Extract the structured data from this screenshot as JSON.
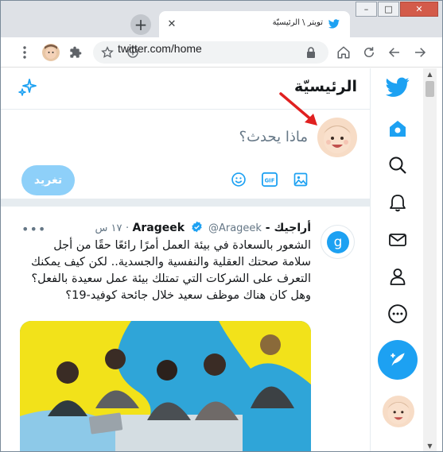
{
  "browser": {
    "tab_title": "تويتر \\ الرئيسيّة",
    "tab_close_icon": "close-icon",
    "new_tab_label": "+",
    "url": "twitter.com/home",
    "window_controls": {
      "minimize": "–",
      "maximize": "□",
      "close": "✕"
    }
  },
  "toolbar": {
    "icons": [
      "menu-dots-icon",
      "profile-avatar",
      "extensions-icon",
      "star-icon",
      "add-icon",
      "lock-icon",
      "home-icon",
      "reload-icon",
      "back-icon",
      "forward-icon"
    ]
  },
  "nav": {
    "items": [
      "twitter-logo",
      "home-icon",
      "explore-icon",
      "notifications-icon",
      "messages-icon",
      "profile-icon",
      "more-icon"
    ],
    "compose": "compose-tweet-icon"
  },
  "header": {
    "title": "الرئيسيّة"
  },
  "composer": {
    "placeholder": "ماذا يحدث؟",
    "gif_label": "GIF",
    "tweet_button": "تغريد"
  },
  "tweet": {
    "name": "أراجيك - Arageek",
    "handle": "@Arageek",
    "separator": "·",
    "time": "١٧ س",
    "more": "•••",
    "text": "الشعور بالسعادة في بيئة العمل أمرًا رائعًا حقًا من أجل سلامة صحتك العقلية والنفسية والجسدية.. لكن كيف يمكنك التعرف على الشركات التي تمتلك بيئة عمل سعيدة بالفعل؟ وهل كان هناك موظف سعيد خلال جائحة كوفيد-19؟",
    "avatar_letter": "g"
  },
  "colors": {
    "twitter_blue": "#1da1f2",
    "tweet_button_disabled": "#8ed0f9",
    "annotation_arrow": "#e02020"
  }
}
